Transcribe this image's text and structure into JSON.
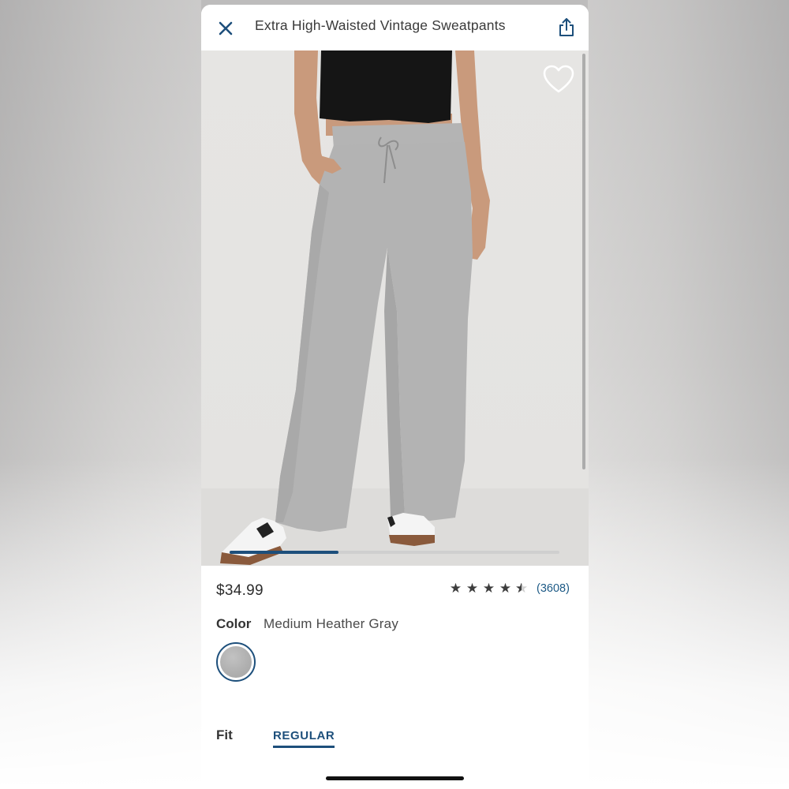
{
  "header": {
    "title": "Extra High-Waisted Vintage Sweatpants",
    "close_icon": "close-icon",
    "share_icon": "share-icon"
  },
  "gallery": {
    "favorite_icon": "heart-outline-icon",
    "image_progress": 0.33
  },
  "product": {
    "price": "$34.99",
    "rating": 4.5,
    "rating_max": 5,
    "review_count": "(3608)",
    "color_label": "Color",
    "color_value": "Medium Heather Gray",
    "fit_label": "Fit",
    "fit_selected": "REGULAR"
  },
  "colors": {
    "accent": "#1d4f7b",
    "text": "#333333",
    "swatch": "#b4b4b4"
  }
}
